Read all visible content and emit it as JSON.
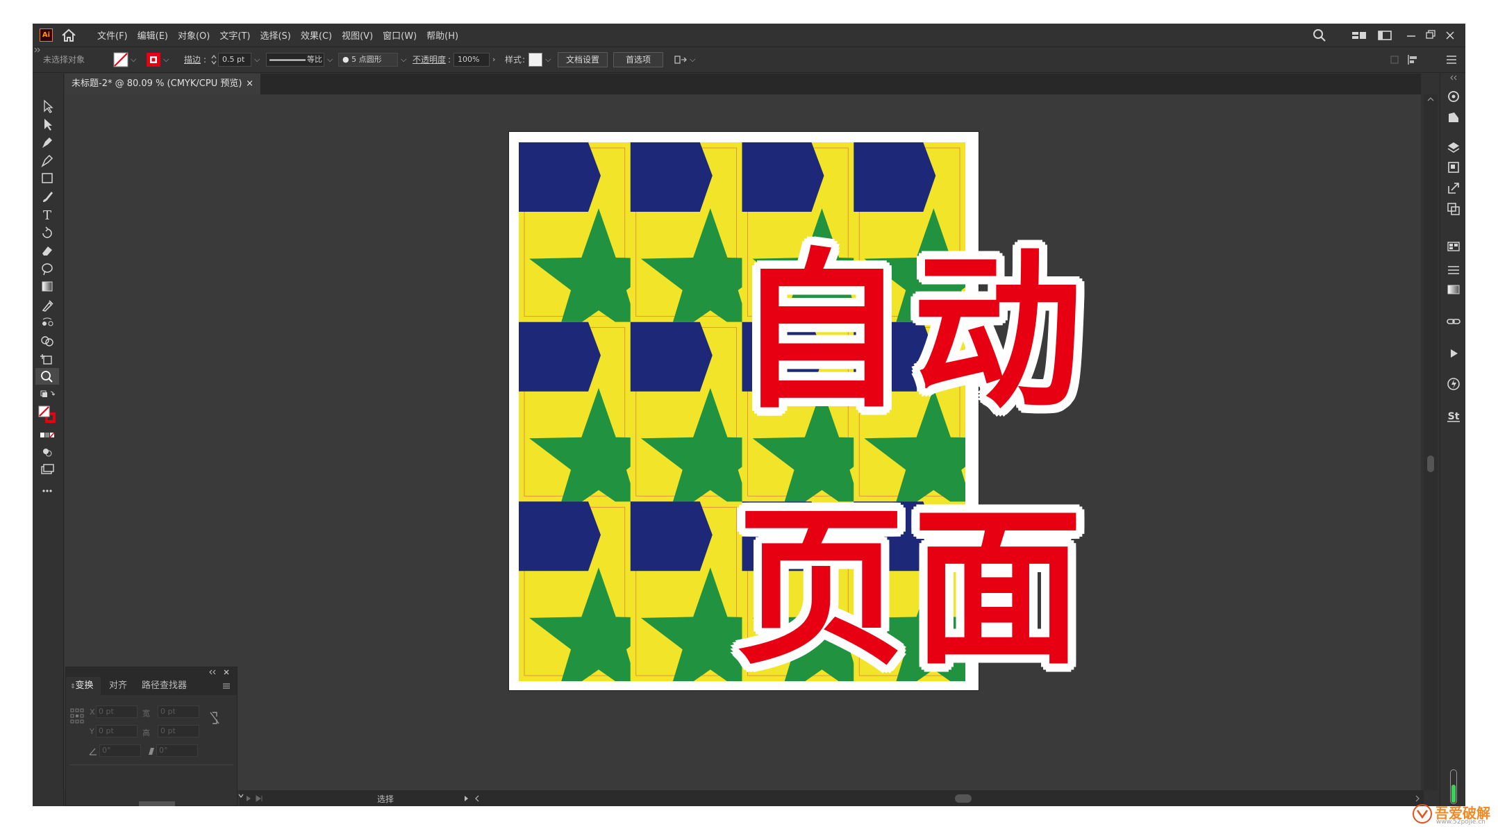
{
  "app": {
    "logo": "Ai",
    "accent_color": "#ff9a00"
  },
  "menu": [
    "文件(F)",
    "编辑(E)",
    "对象(O)",
    "文字(T)",
    "选择(S)",
    "效果(C)",
    "视图(V)",
    "窗口(W)",
    "帮助(H)"
  ],
  "controlbar": {
    "selection": "未选择对象",
    "stroke_label": "描边",
    "stroke_value": "0.5 pt",
    "stroke_profile": "等比",
    "brush": "5 点圆形",
    "opacity_label": "不透明度",
    "opacity_value": "100%",
    "style_label": "样式",
    "doc_setup": "文档设置",
    "preferences": "首选项"
  },
  "document_tab": {
    "title": "未标题-2* @ 80.09 % (CMYK/CPU 预览)",
    "close": "×"
  },
  "overlay": {
    "line1": "自动",
    "line2": "页面",
    "color": "#e60012"
  },
  "pattern": {
    "bg": "#f2e529",
    "hex_color": "#1e2878",
    "star_color": "#21923f",
    "guide_color": "#d9534f"
  },
  "transform_panel": {
    "tabs": [
      "变换",
      "对齐",
      "路径查找器"
    ],
    "x_label": "X",
    "y_label": "Y",
    "w_label": "宽",
    "h_label": "高",
    "x": "0 pt",
    "y": "0 pt",
    "w": "0 pt",
    "h": "0 pt",
    "angle": "0°",
    "shear": "0°"
  },
  "statusbar": {
    "tool": "选择"
  },
  "watermark": {
    "text": "吾爱破解",
    "url": "www.52pojie.cn"
  }
}
